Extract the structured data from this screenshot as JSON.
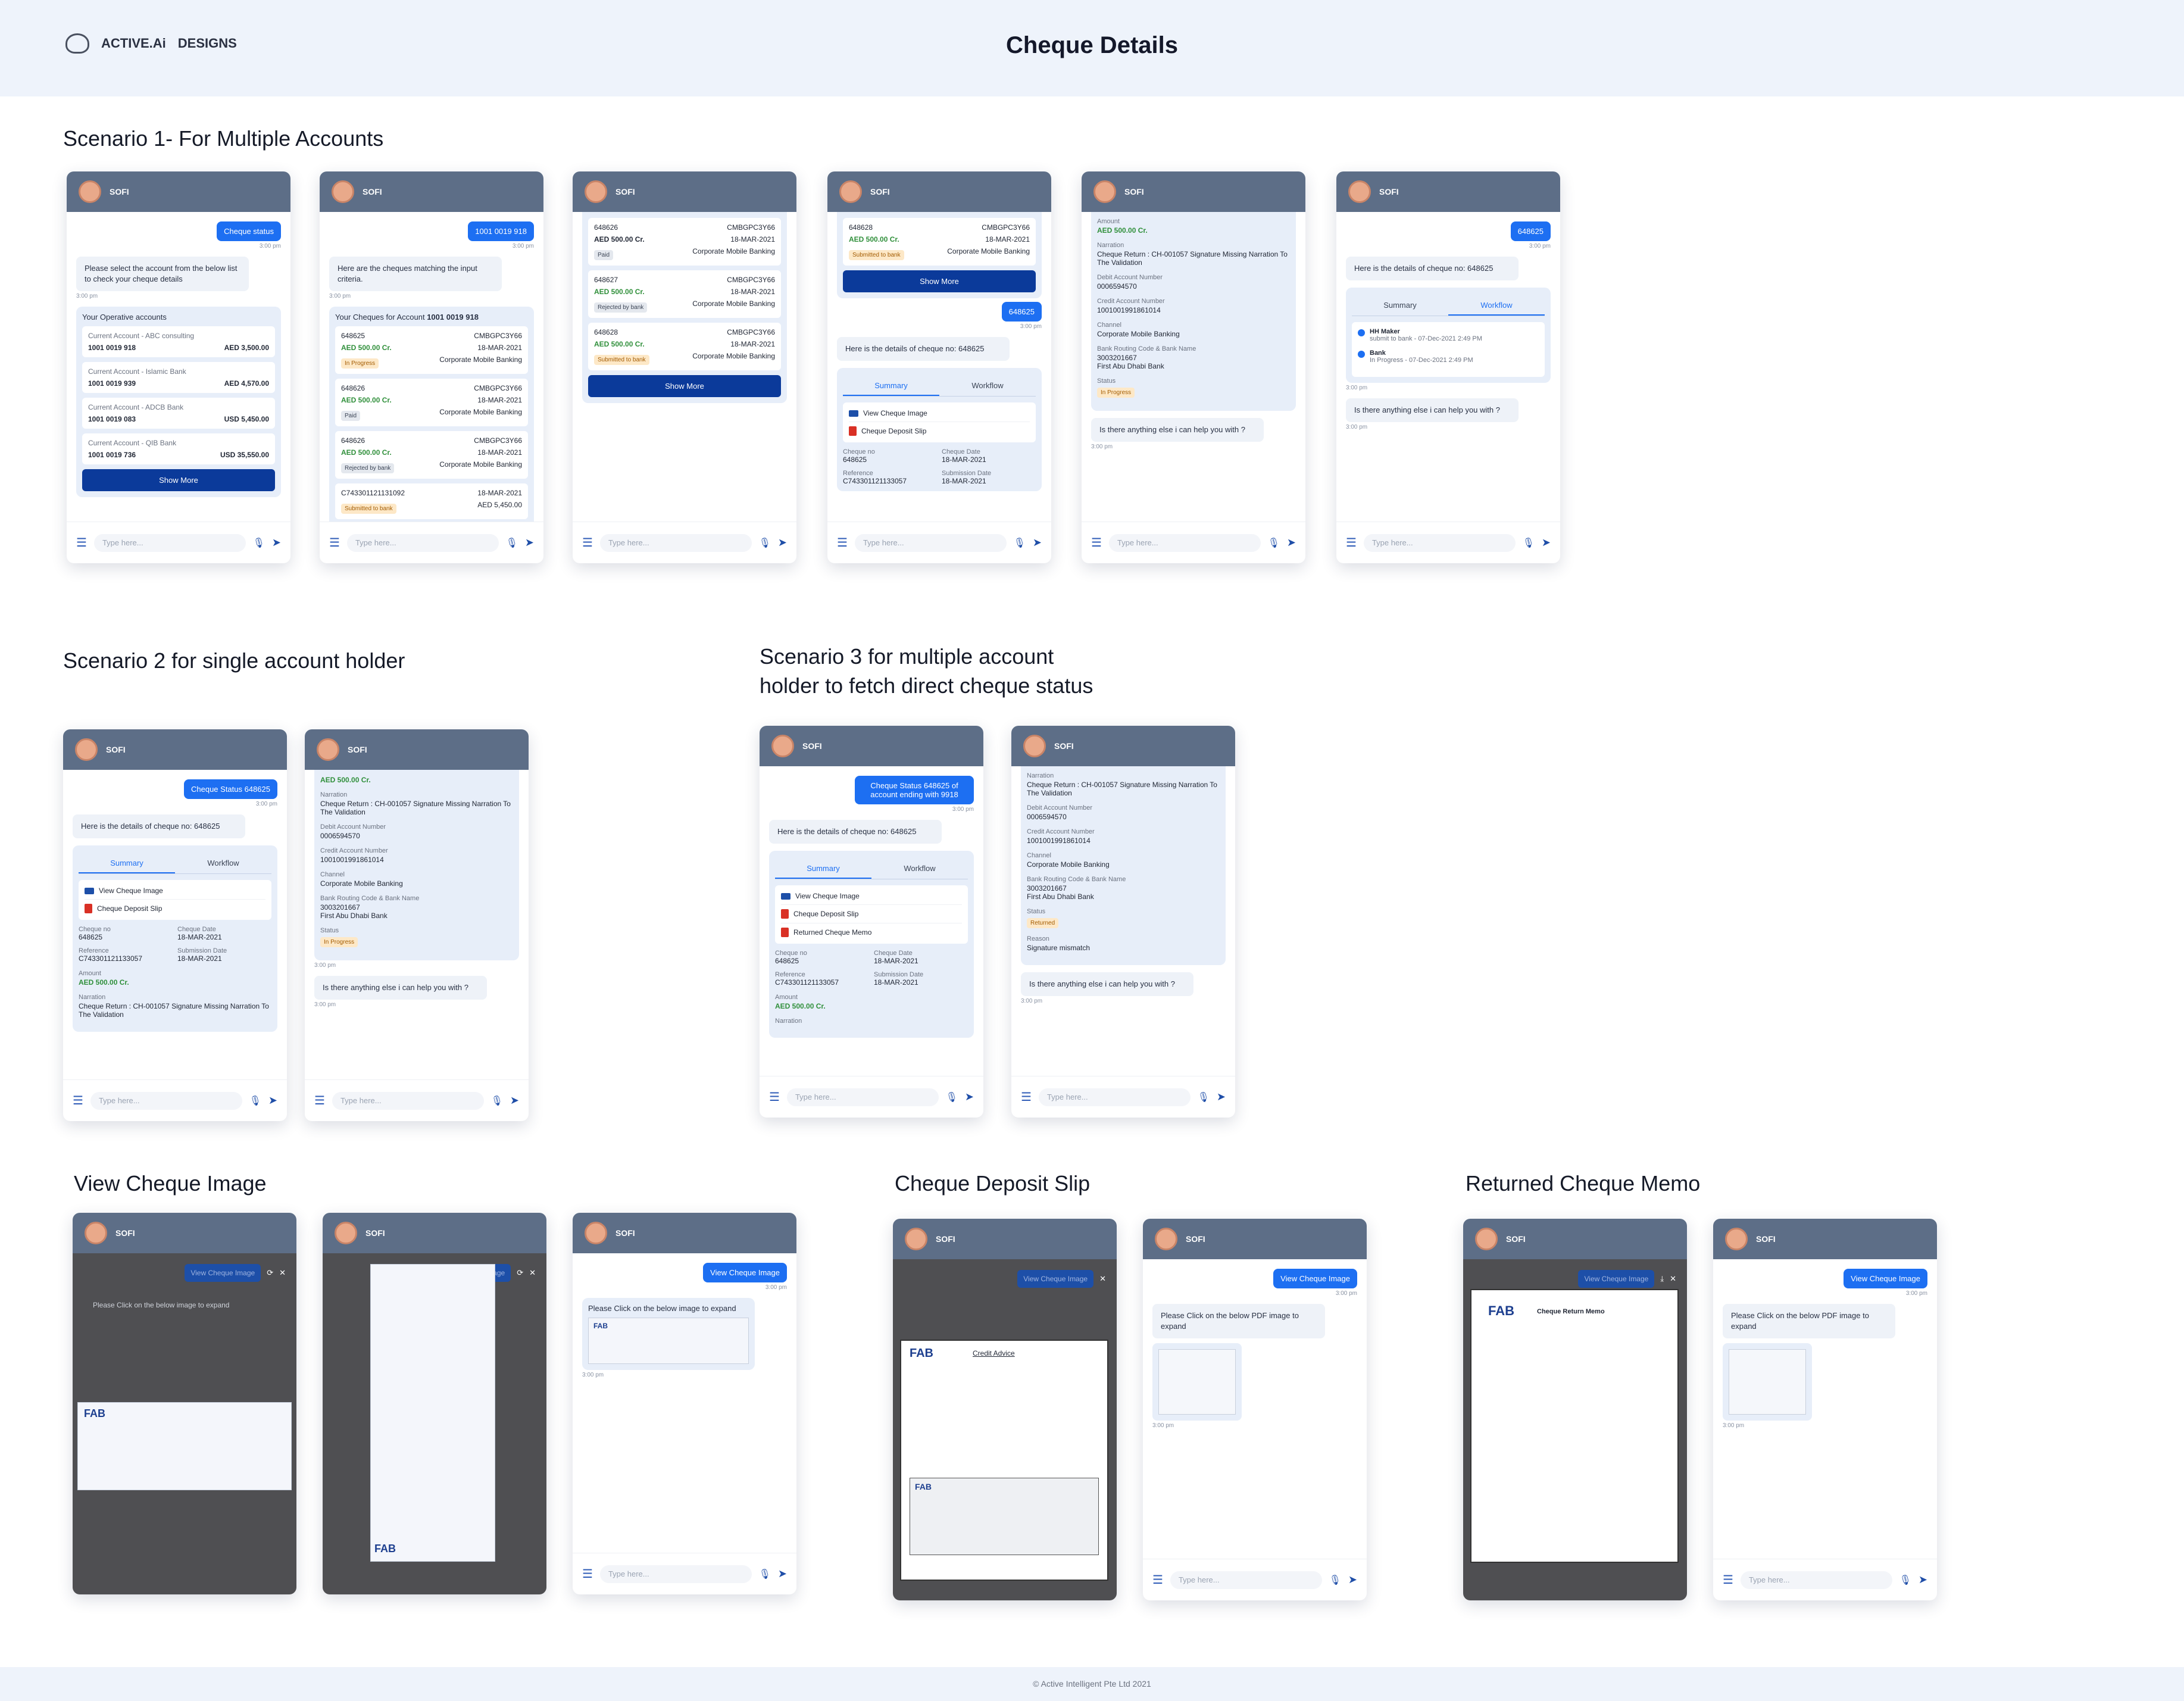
{
  "header": {
    "logo": "ACTIVE.Ai",
    "designs": "DESIGNS",
    "title": "Cheque Details"
  },
  "footer": "© Active Intelligent Pte Ltd 2021",
  "common": {
    "bot": "SOFI",
    "placeholder": "Type here...",
    "time": "3:00 pm",
    "show_more": "Show More",
    "summary": "Summary",
    "workflow": "Workflow",
    "view_image": "View Cheque Image",
    "deposit_slip": "Cheque Deposit Slip",
    "returned_memo": "Returned Cheque Memo",
    "anything_else": "Is there anything else i can help you with ?",
    "details_msg": "Here is the details of cheque no: 648625",
    "click_image": "Please Click on the below image to expand",
    "click_pdf": "Please Click on the below PDF image to expand"
  },
  "sections": {
    "s1": "Scenario 1- For Multiple Accounts",
    "s2": "Scenario 2 for single account holder",
    "s3a": "Scenario 3 for multiple account",
    "s3b": "holder to fetch direct cheque status",
    "v1": "View Cheque Image",
    "v2": "Cheque Deposit Slip",
    "v3": "Returned Cheque Memo"
  },
  "p1": {
    "user": "Cheque status",
    "bot": "Please select the account from the below list to check your cheque details",
    "card_title": "Your Operative accounts",
    "accounts": [
      {
        "type": "Current Account - ABC consulting",
        "no": "1001 0019 918",
        "bal": "AED 3,500.00"
      },
      {
        "type": "Current Account - Islamic Bank",
        "no": "1001 0019 939",
        "bal": "AED 4,570.00"
      },
      {
        "type": "Current Account - ADCB Bank",
        "no": "1001 0019 083",
        "bal": "USD 5,450.00"
      },
      {
        "type": "Current Account - QIB Bank",
        "no": "1001 0019 736",
        "bal": "USD 35,550.00"
      }
    ]
  },
  "p2": {
    "user": "1001 0019 918",
    "bot": "Here are the cheques matching the input criteria.",
    "card_title": "Your Cheques for Account",
    "card_acc": "1001 0019 918",
    "cheques": [
      {
        "no": "648625",
        "ref": "CMBGPC3Y66",
        "amt": "AED 500.00 Cr.",
        "date": "18-MAR-2021",
        "status": "In Progress",
        "ch": "Corporate Mobile Banking"
      },
      {
        "no": "648626",
        "ref": "CMBGPC3Y66",
        "amt": "AED 500.00 Cr.",
        "date": "18-MAR-2021",
        "status": "Paid",
        "ch": "Corporate Mobile Banking"
      },
      {
        "no": "648626",
        "ref": "CMBGPC3Y66",
        "amt": "AED 500.00 Cr.",
        "date": "18-MAR-2021",
        "status": "Rejected by bank",
        "ch": "Corporate Mobile Banking"
      }
    ],
    "last_no": "C743301121131092",
    "last_date": "18-MAR-2021",
    "last_status": "Submitted to bank",
    "last_amt": "AED 5,450.00"
  },
  "p3": {
    "cheques": [
      {
        "no": "648626",
        "ref": "CMBGPC3Y66",
        "amt": "AED 500.00 Cr.",
        "date": "18-MAR-2021",
        "status": "Paid",
        "ch": "Corporate Mobile Banking"
      },
      {
        "no": "648627",
        "ref": "CMBGPC3Y66",
        "amt": "AED 500.00 Cr.",
        "date": "18-MAR-2021",
        "status": "Rejected by bank",
        "ch": "Corporate Mobile Banking"
      },
      {
        "no": "648628",
        "ref": "CMBGPC3Y66",
        "amt": "AED 500.00 Cr.",
        "date": "18-MAR-2021",
        "status": "Submitted to bank",
        "ch": "Corporate Mobile Banking"
      }
    ]
  },
  "p4": {
    "cheque": {
      "no": "648628",
      "ref": "CMBGPC3Y66",
      "amt": "AED 500.00 Cr.",
      "date": "18-MAR-2021",
      "status": "Submitted to bank",
      "ch": "Corporate Mobile Banking"
    },
    "user": "648625"
  },
  "details": {
    "cheque_no_l": "Cheque no",
    "cheque_no": "648625",
    "cheque_date_l": "Cheque Date",
    "cheque_date": "18-MAR-2021",
    "ref_l": "Reference",
    "ref": "C743301121133057",
    "sub_l": "Submission Date",
    "sub": "18-MAR-2021",
    "amount_l": "Amount",
    "amount": "AED 500.00 Cr.",
    "narr_l": "Narration",
    "narr": "Cheque Return : CH-001057 Signature Missing Narration To The Validation",
    "debit_l": "Debit Account Number",
    "debit": "0006594570",
    "credit_l": "Credit Account Number",
    "credit": "1001001991861014",
    "channel_l": "Channel",
    "channel": "Corporate Mobile Banking",
    "routing_l": "Bank Routing Code & Bank Name",
    "routing": "3003201667",
    "bank": "First Abu Dhabi Bank",
    "status_l": "Status",
    "status": "In Progress",
    "status_ret": "Returned",
    "reason_l": "Reason",
    "reason": "Signature mismatch"
  },
  "p6": {
    "user": "648625",
    "wf": [
      {
        "t": "HH Maker",
        "s": "submit to bank - 07-Dec-2021 2:49 PM"
      },
      {
        "t": "Bank",
        "s": "In Progress - 07-Dec-2021 2:49 PM"
      }
    ]
  },
  "s2": {
    "user": "Cheque Status 648625"
  },
  "s3": {
    "user": "Cheque Status 648625 of account ending with 9918"
  },
  "docs": {
    "fab": "FAB",
    "credit_advice": "Credit Advice",
    "return_memo": "Cheque Return Memo"
  }
}
